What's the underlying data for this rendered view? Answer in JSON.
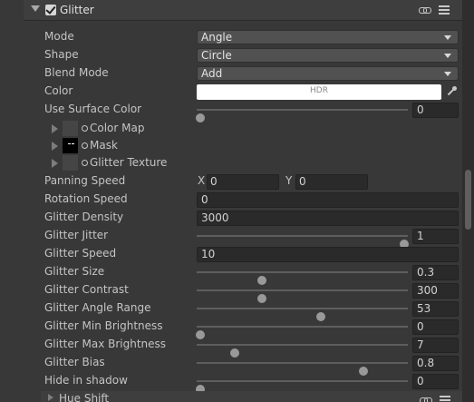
{
  "section": {
    "title": "Glitter",
    "enabled": true
  },
  "mode": {
    "label": "Mode",
    "value": "Angle"
  },
  "shape": {
    "label": "Shape",
    "value": "Circle"
  },
  "blend_mode": {
    "label": "Blend Mode",
    "value": "Add"
  },
  "color": {
    "label": "Color",
    "hdr_text": "HDR",
    "value_hex": "#ffffff"
  },
  "use_surface_color": {
    "label": "Use Surface Color",
    "value": "0",
    "fraction": 0.0
  },
  "textures": [
    {
      "label": "Color Map",
      "thumbnail": "empty"
    },
    {
      "label": "Mask",
      "thumbnail": "black"
    },
    {
      "label": "Glitter Texture",
      "thumbnail": "empty"
    }
  ],
  "panning_speed": {
    "label": "Panning Speed",
    "x_label": "X",
    "x_value": "0",
    "y_label": "Y",
    "y_value": "0"
  },
  "rotation_speed": {
    "label": "Rotation Speed",
    "value": "0"
  },
  "glitter_density": {
    "label": "Glitter Density",
    "value": "3000"
  },
  "glitter_jitter": {
    "label": "Glitter Jitter",
    "value": "1",
    "fraction": 1.0
  },
  "glitter_speed": {
    "label": "Glitter Speed",
    "value": "10"
  },
  "glitter_size": {
    "label": "Glitter Size",
    "value": "0.3",
    "fraction": 0.3
  },
  "glitter_contrast": {
    "label": "Glitter Contrast",
    "value": "300",
    "fraction": 0.3
  },
  "glitter_angle_range": {
    "label": "Glitter Angle Range",
    "value": "53",
    "fraction": 0.59
  },
  "glitter_min_brightness": {
    "label": "Glitter Min Brightness",
    "value": "0",
    "fraction": 0.0
  },
  "glitter_max_brightness": {
    "label": "Glitter Max Brightness",
    "value": "7",
    "fraction": 0.17
  },
  "glitter_bias": {
    "label": "Glitter Bias",
    "value": "0.8",
    "fraction": 0.8
  },
  "hide_in_shadow": {
    "label": "Hide in shadow",
    "value": "0",
    "fraction": 0.0
  },
  "next_section": {
    "title": "Hue Shift"
  },
  "colors": {
    "background": "#383838",
    "field": "#2a2a2a",
    "dropdown": "#515151",
    "thumb": "#999999"
  }
}
